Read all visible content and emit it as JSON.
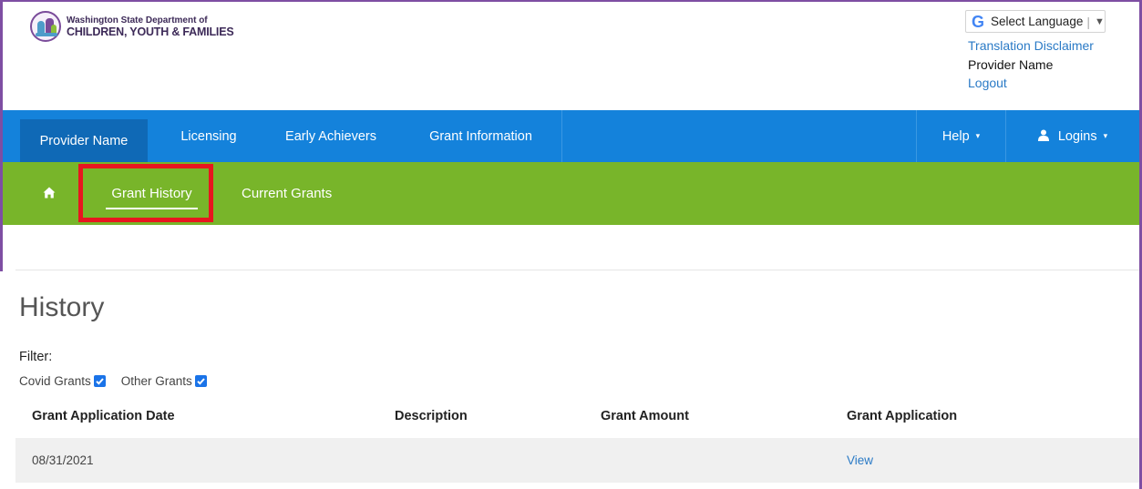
{
  "header": {
    "logo": {
      "line1": "Washington State Department of",
      "line2": "CHILDREN, YOUTH & FAMILIES"
    },
    "language": {
      "icon": "google-g-icon",
      "label": "Select Language",
      "separator": "|",
      "caret": "▼"
    },
    "translation_disclaimer": "Translation Disclaimer",
    "provider_name": "Provider Name",
    "logout": "Logout"
  },
  "main_nav": {
    "items": [
      {
        "label": "Provider Name"
      },
      {
        "label": "Licensing"
      },
      {
        "label": "Early Achievers"
      },
      {
        "label": "Grant Information"
      }
    ],
    "help": {
      "label": "Help",
      "caret": "▾"
    },
    "logins": {
      "label": "Logins",
      "caret": "▾",
      "icon": "user-icon"
    }
  },
  "sub_nav": {
    "home_icon": "home-icon",
    "items": [
      {
        "label": "Grant History"
      },
      {
        "label": "Current Grants"
      }
    ]
  },
  "page": {
    "title": "History",
    "filter_label": "Filter:",
    "filters": [
      {
        "label": "Covid Grants",
        "checked": true
      },
      {
        "label": "Other Grants",
        "checked": true
      }
    ]
  },
  "table": {
    "columns": [
      "Grant Application Date",
      "Description",
      "Grant Amount",
      "Grant Application"
    ],
    "rows": [
      {
        "date": "08/31/2021",
        "description": "",
        "amount": "",
        "application": "View"
      }
    ]
  },
  "colors": {
    "nav_blue": "#1482db",
    "nav_active": "#0f69b6",
    "sub_nav_green": "#78b52a",
    "highlight_red": "#e8161f",
    "link_blue": "#2a7ac6",
    "frame_purple": "#7e4ea3"
  }
}
